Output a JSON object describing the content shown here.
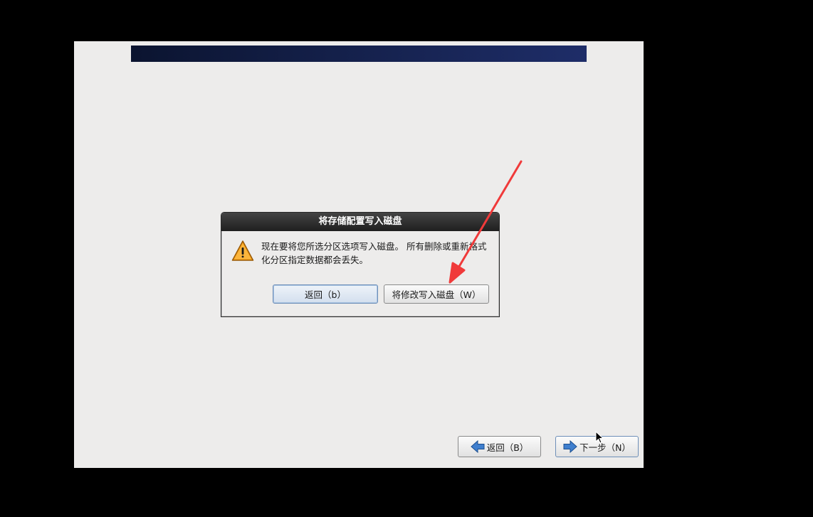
{
  "dialog": {
    "title": "将存储配置写入磁盘",
    "message": "现在要将您所选分区选项写入磁盘。 所有删除或重新格式化分区指定数据都会丢失。",
    "back_label": "返回（b）",
    "write_label": "将修改写入磁盘（W）",
    "icon": "warning-icon"
  },
  "nav": {
    "back_label": "返回（B）",
    "next_label": "下一步（N）",
    "back_icon": "arrow-left-icon",
    "next_icon": "arrow-right-icon"
  },
  "colors": {
    "annotation_arrow": "#f03a3a",
    "banner": "#14204a",
    "window_bg": "#edeceb"
  }
}
